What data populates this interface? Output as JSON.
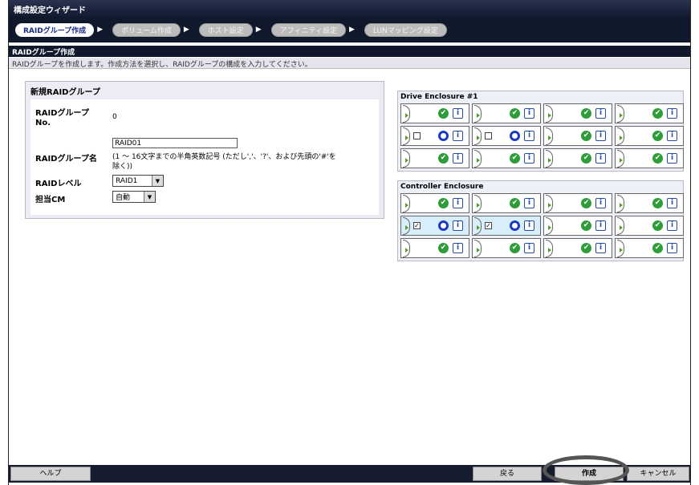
{
  "window": {
    "title": "構成設定ウィザード"
  },
  "steps": [
    {
      "label": "RAIDグループ作成"
    },
    {
      "label": "ボリューム作成"
    },
    {
      "label": "ホスト設定"
    },
    {
      "label": "アフィニティ設定"
    },
    {
      "label": "LUNマッピング設定"
    }
  ],
  "page": {
    "heading": "RAIDグループ作成",
    "description": "RAIDグループを作成します。作成方法を選択し、RAIDグループの構成を入力してください。"
  },
  "form": {
    "panel_title": "新規RAIDグループ",
    "raid_no_label_1": "RAIDグループ",
    "raid_no_label_2": "No.",
    "raid_no_value": "0",
    "raid_name_label": "RAIDグループ名",
    "raid_name_value": "RAID01",
    "raid_name_hint_1": "(1 ～ 16文字までの半角英数記号 (ただし','、'?'、および先頭の'#'を",
    "raid_name_hint_2": "除く))",
    "raid_level_label": "RAIDレベル",
    "raid_level_value": "RAID1",
    "cm_label": "担当CM",
    "cm_value": "自動"
  },
  "enclosures": [
    {
      "title": "Drive Enclosure #1",
      "rows": [
        [
          "ok",
          "ok",
          "ok",
          "ok"
        ],
        [
          "unchecked",
          "unchecked",
          "ok",
          "ok"
        ],
        [
          "ok",
          "ok",
          "ok",
          "ok"
        ]
      ]
    },
    {
      "title": "Controller Enclosure",
      "rows": [
        [
          "ok",
          "ok",
          "ok",
          "ok"
        ],
        [
          "checked",
          "checked",
          "ok",
          "ok"
        ],
        [
          "ok",
          "ok",
          "ok",
          "ok"
        ]
      ]
    }
  ],
  "icons": {
    "ok_glyph": "✔",
    "info_glyph": "i",
    "checkmark_glyph": "✓",
    "step_arrow": "▶",
    "dropdown_glyph": "▼"
  },
  "footer": {
    "help_label": "ヘルプ",
    "back_label": "戻る",
    "create_label": "作成",
    "cancel_label": "キャンセル"
  }
}
